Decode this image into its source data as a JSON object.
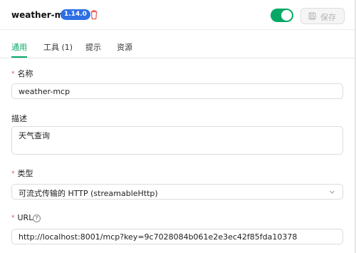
{
  "header": {
    "server_name": "weather-mcp",
    "version": "1.14.0",
    "enabled": true,
    "save_label": "保存",
    "accent_color": "#07a866",
    "badge_color": "#2f6fe4",
    "delete_icon": "trash-icon",
    "save_icon": "save-icon"
  },
  "tabs": [
    {
      "label": "通用",
      "active": true
    },
    {
      "label": "工具 (1)",
      "active": false
    },
    {
      "label": "提示",
      "active": false
    },
    {
      "label": "资源",
      "active": false
    }
  ],
  "form": {
    "name": {
      "label": "名称",
      "required": true,
      "value": "weather-mcp"
    },
    "description": {
      "label": "描述",
      "required": false,
      "value": "天气查询"
    },
    "type": {
      "label": "类型",
      "required": true,
      "value": "可流式传输的 HTTP (streamableHttp)"
    },
    "url": {
      "label": "URL",
      "required": true,
      "help_icon": "help-circle-icon",
      "value": "http://localhost:8001/mcp?key=9c7028084b061e2e3ec42f85fda10378"
    }
  }
}
